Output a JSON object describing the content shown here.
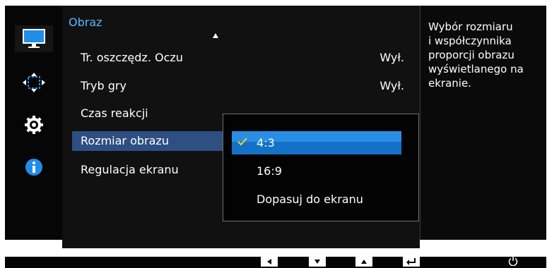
{
  "sidebar": {
    "icons": [
      "monitor-icon",
      "arrows-icon",
      "gear-icon",
      "info-icon"
    ],
    "colors": {
      "accent": "#1f8ee8"
    }
  },
  "menu": {
    "title": "Obraz",
    "items": [
      {
        "label": "Tr. oszczędz. Oczu",
        "value": "Wył."
      },
      {
        "label": "Tryb gry",
        "value": "Wył."
      },
      {
        "label": "Czas reakcji",
        "value": ""
      },
      {
        "label": "Rozmiar obrazu",
        "value": ""
      },
      {
        "label": "Regulacja ekranu",
        "value": ""
      }
    ],
    "selected_index": 3
  },
  "submenu": {
    "options": [
      {
        "label": "4:3"
      },
      {
        "label": "16:9"
      },
      {
        "label": "Dopasuj do ekranu"
      }
    ],
    "selected_index": 0
  },
  "description": {
    "text": "Wybór rozmiaru\ni współczynnika\nproporcji obrazu\nwyświetlanego na\nekranie."
  },
  "bottom_bar": {
    "buttons": [
      "left-arrow-icon",
      "down-arrow-icon",
      "up-arrow-icon",
      "enter-icon",
      "power-icon"
    ]
  }
}
